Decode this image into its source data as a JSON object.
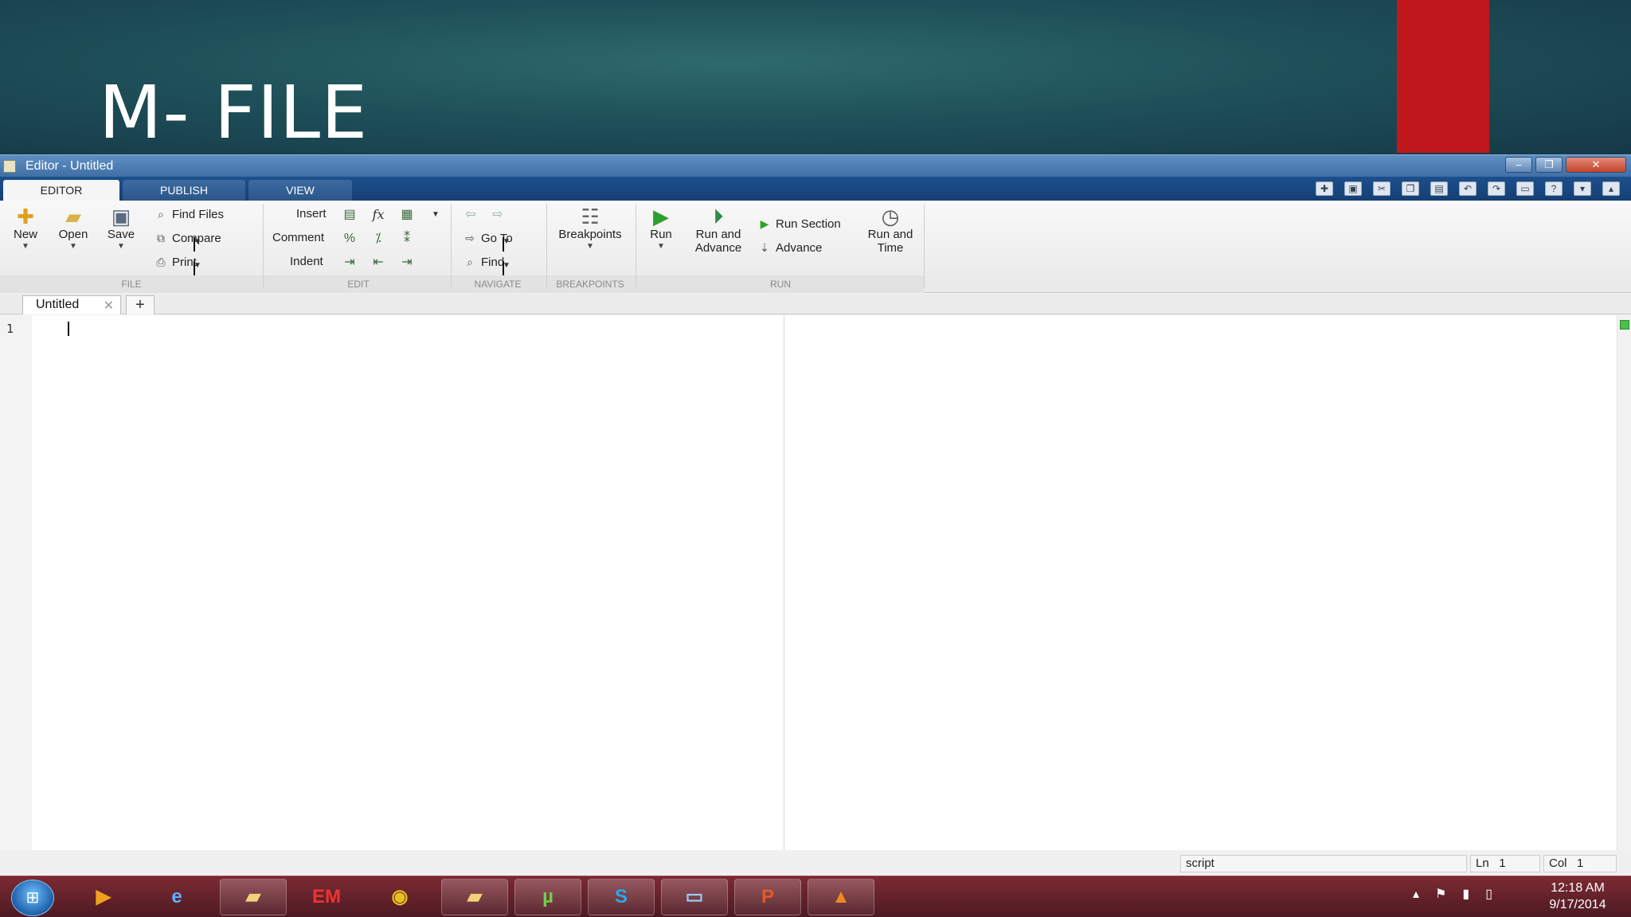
{
  "slide": {
    "title": "M- FILE"
  },
  "window": {
    "title": "Editor - Untitled",
    "controls": {
      "minimize": "–",
      "restore": "❐",
      "close": "✕"
    }
  },
  "ribbon_tabs": [
    "EDITOR",
    "PUBLISH",
    "VIEW"
  ],
  "ribbon": {
    "file": {
      "group_label": "FILE",
      "new": "New",
      "open": "Open",
      "save": "Save",
      "find_files": "Find Files",
      "compare": "Compare",
      "print": "Print"
    },
    "edit": {
      "group_label": "EDIT",
      "insert": "Insert",
      "comment": "Comment",
      "indent": "Indent",
      "fx": "fx",
      "percent": "%"
    },
    "navigate": {
      "group_label": "NAVIGATE",
      "go_to": "Go To",
      "find": "Find"
    },
    "breakpoints": {
      "group_label": "BREAKPOINTS",
      "breakpoints": "Breakpoints"
    },
    "run": {
      "group_label": "RUN",
      "run": "Run",
      "run_and_advance_1": "Run and",
      "run_and_advance_2": "Advance",
      "run_section": "Run Section",
      "advance": "Advance",
      "run_and_time_1": "Run and",
      "run_and_time_2": "Time"
    }
  },
  "document_tabs": {
    "active": "Untitled",
    "close": "✕",
    "add": "+"
  },
  "editor": {
    "line_numbers": [
      "1"
    ],
    "content": ""
  },
  "status_bar": {
    "file_type": "script",
    "ln_label": "Ln",
    "ln_value": "1",
    "col_label": "Col",
    "col_value": "1"
  },
  "taskbar": {
    "items": [
      "media-player",
      "internet-explorer",
      "file-explorer",
      "em-app",
      "chrome",
      "folder",
      "utorrent",
      "skype",
      "monitor",
      "powerpoint",
      "matlab"
    ],
    "clock_time": "12:18 AM",
    "clock_date": "9/17/2014"
  },
  "colors": {
    "slide_bg": "#1f5059",
    "accent_red": "#c0181d",
    "ribbon_tab_bar": "#1c4f8d",
    "taskbar": "#6a2430"
  }
}
